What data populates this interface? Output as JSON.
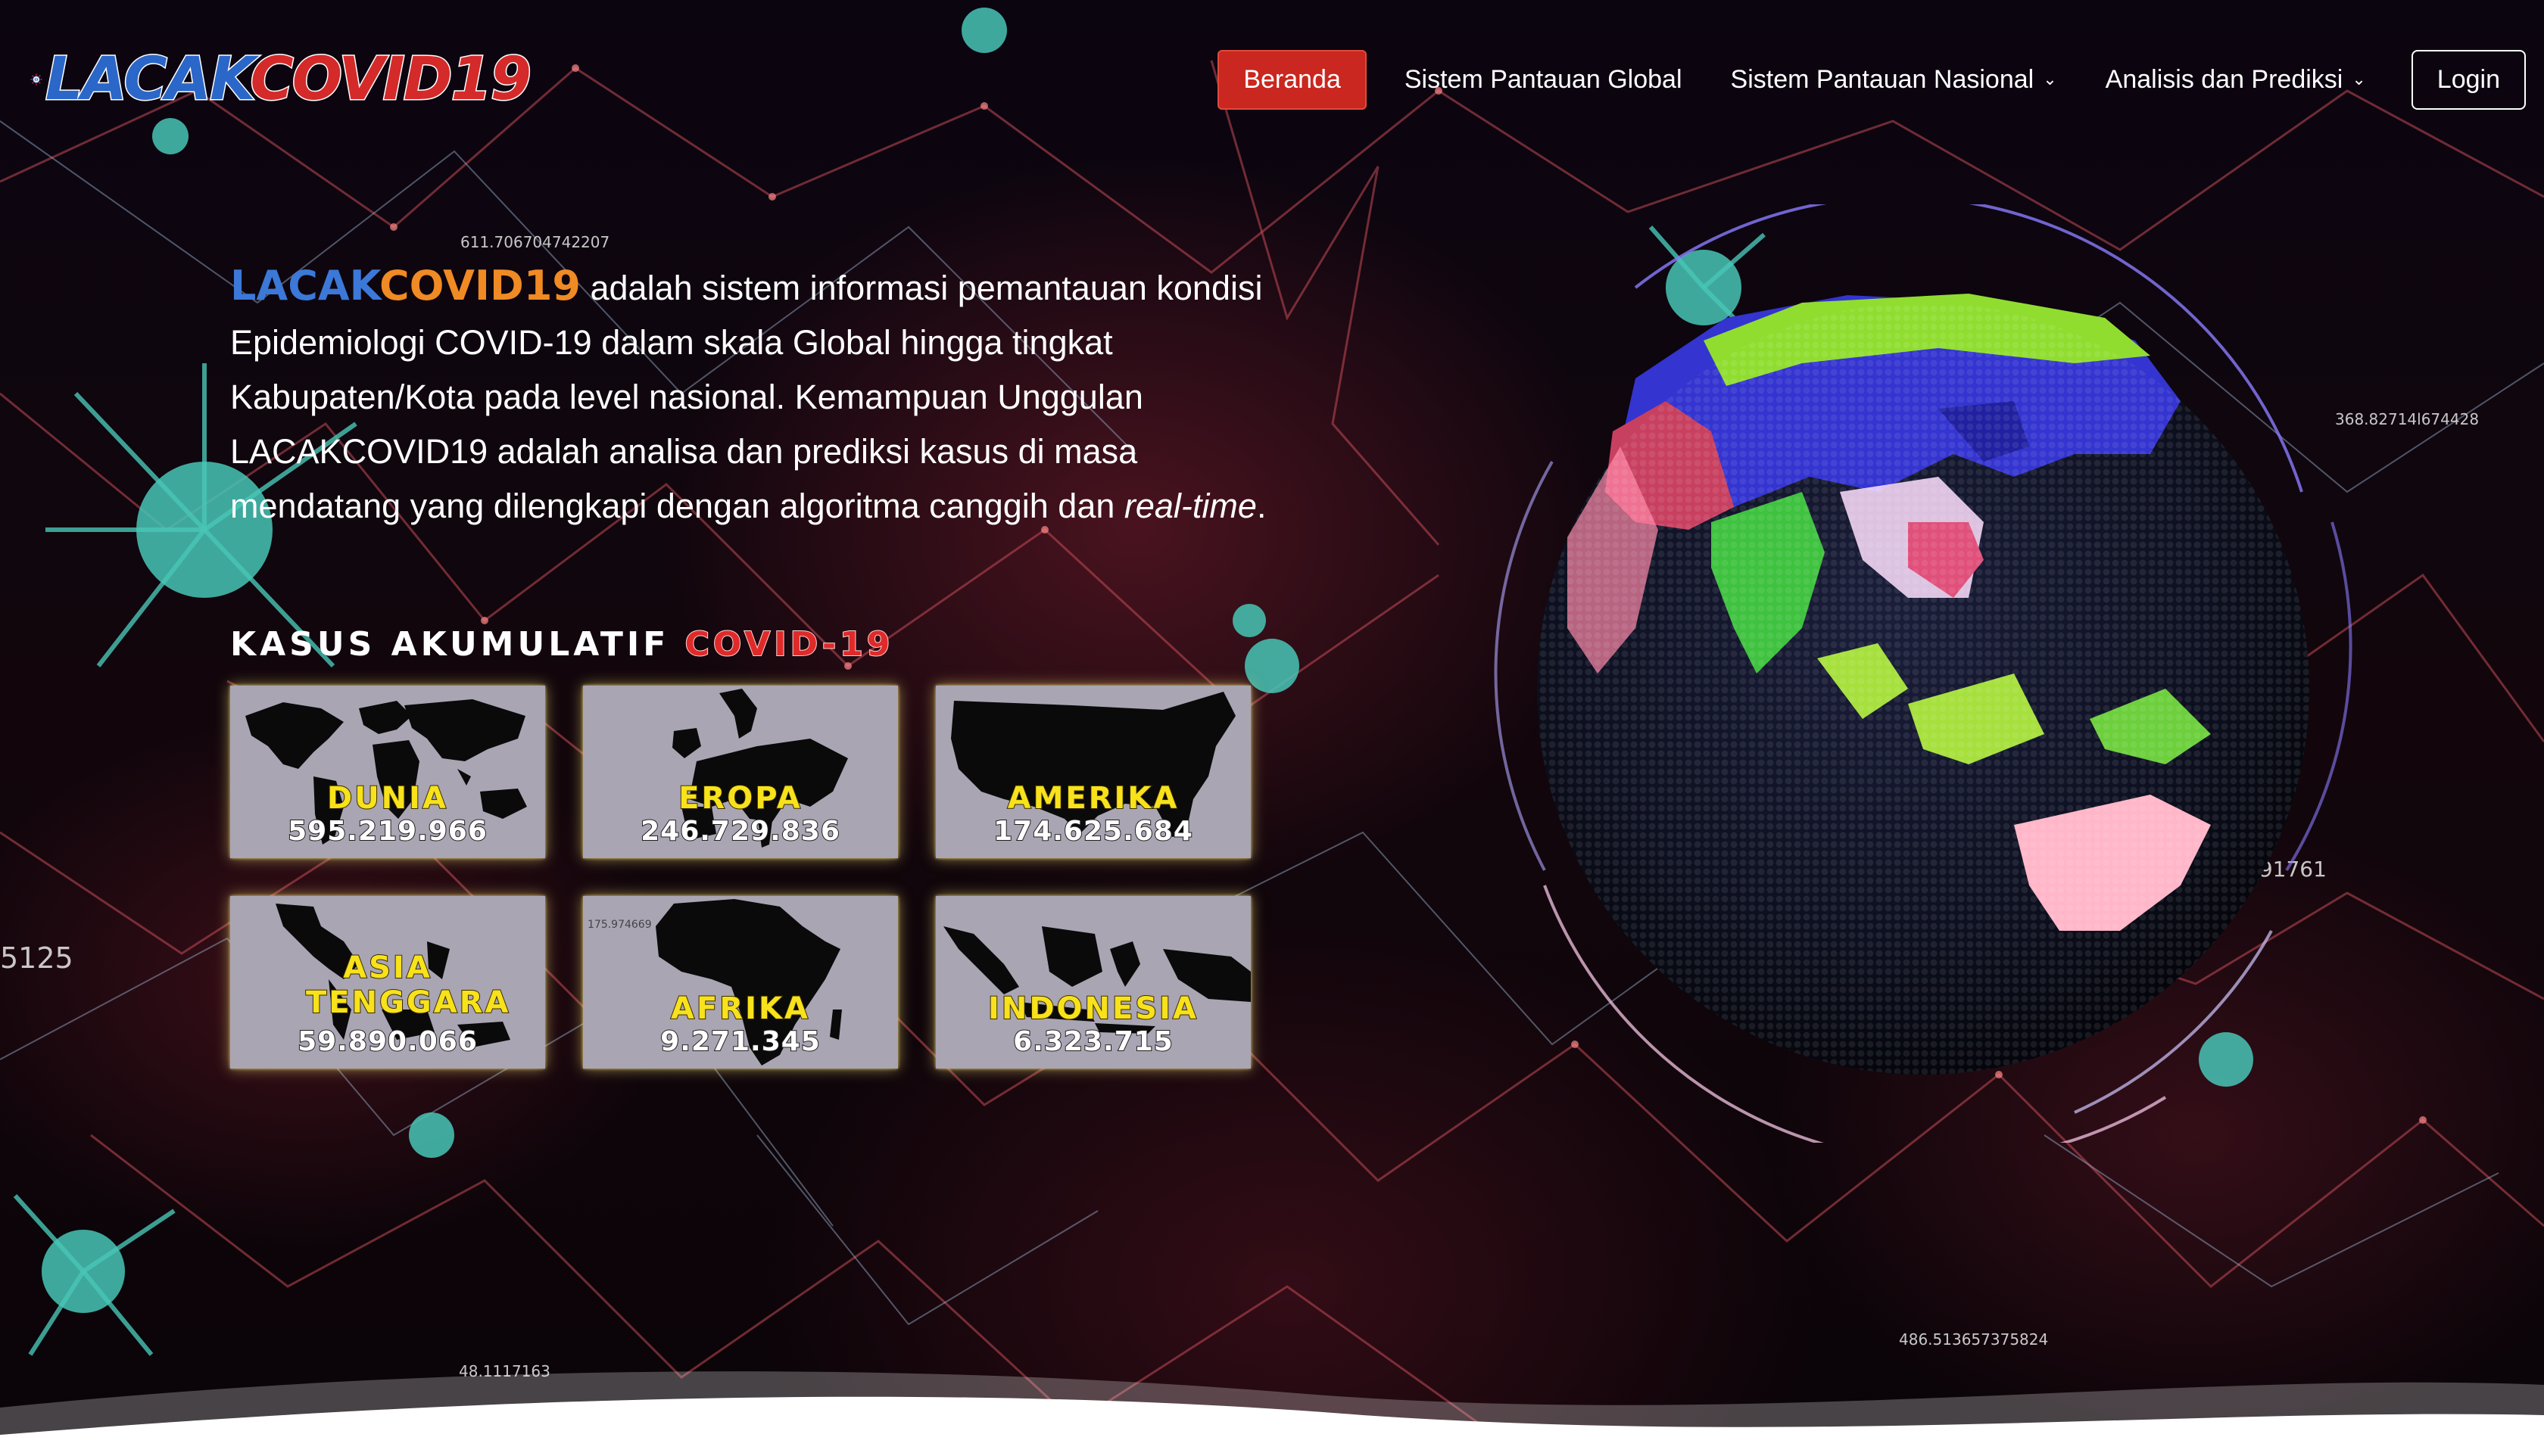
{
  "brand": {
    "part1": "LACAK",
    "part2": "COVID19"
  },
  "nav": {
    "items": [
      {
        "label": "Beranda",
        "active": true,
        "dropdown": false
      },
      {
        "label": "Sistem Pantauan Global",
        "active": false,
        "dropdown": false
      },
      {
        "label": "Sistem Pantauan Nasional",
        "active": false,
        "dropdown": true
      },
      {
        "label": "Analisis dan Prediksi",
        "active": false,
        "dropdown": true
      }
    ],
    "login": "Login"
  },
  "intro": {
    "brand_a": "LACAK",
    "brand_b": "COVID19",
    "text1": " adalah sistem informasi pemantauan kondisi Epidemiologi COVID-19 dalam skala Global hingga tingkat Kabupaten/Kota pada level nasional. Kemampuan Unggulan LACAKCOVID19 adalah analisa dan prediksi kasus di masa mendatang yang dilengkapi dengan algoritma canggih dan ",
    "emph": "real-time",
    "text2": "."
  },
  "stats": {
    "heading_white": "KASUS AKUMULATIF ",
    "heading_red": "COVID-19",
    "cards": [
      {
        "name": "DUNIA",
        "value": "595.219.966",
        "map": "world"
      },
      {
        "name": "EROPA",
        "value": "246.729.836",
        "map": "europe"
      },
      {
        "name": "AMERIKA",
        "value": "174.625.684",
        "map": "usa"
      },
      {
        "name": "ASIA TENGGARA",
        "value": "59.890.066",
        "map": "sea"
      },
      {
        "name": "AFRIKA",
        "value": "9.271.345",
        "map": "africa"
      },
      {
        "name": "INDONESIA",
        "value": "6.323.715",
        "map": "indonesia"
      }
    ]
  },
  "background_numbers": [
    "611.706704742207",
    "368.82714l674428",
    "991761",
    "5125",
    "48.1117163",
    "486.513657375824",
    "175.974669"
  ],
  "colors": {
    "accent_red": "#c9271f",
    "brand_blue": "#2b67c8",
    "brand_red": "#d42a2a",
    "card_label": "#f7e21b",
    "virus": "#45c9b8",
    "network": "#c9444f"
  }
}
